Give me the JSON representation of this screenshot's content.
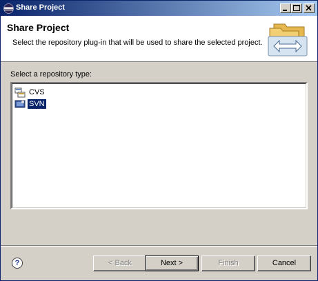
{
  "window": {
    "title": "Share Project",
    "controls": [
      "minimize",
      "maximize",
      "close"
    ]
  },
  "header": {
    "title": "Share Project",
    "description": "Select the repository plug-in that will be used to share the selected project."
  },
  "repository": {
    "label": "Select a repository type:",
    "items": [
      {
        "label": "CVS",
        "icon": "cvs-icon",
        "selected": false
      },
      {
        "label": "SVN",
        "icon": "svn-icon",
        "selected": true
      }
    ]
  },
  "footer": {
    "help_symbol": "?",
    "back_label": "< Back",
    "next_label": "Next >",
    "finish_label": "Finish",
    "cancel_label": "Cancel"
  },
  "colors": {
    "title_bar": "#0a246a",
    "dialog_bg": "#d4d0c8",
    "selection": "#0a246a"
  }
}
